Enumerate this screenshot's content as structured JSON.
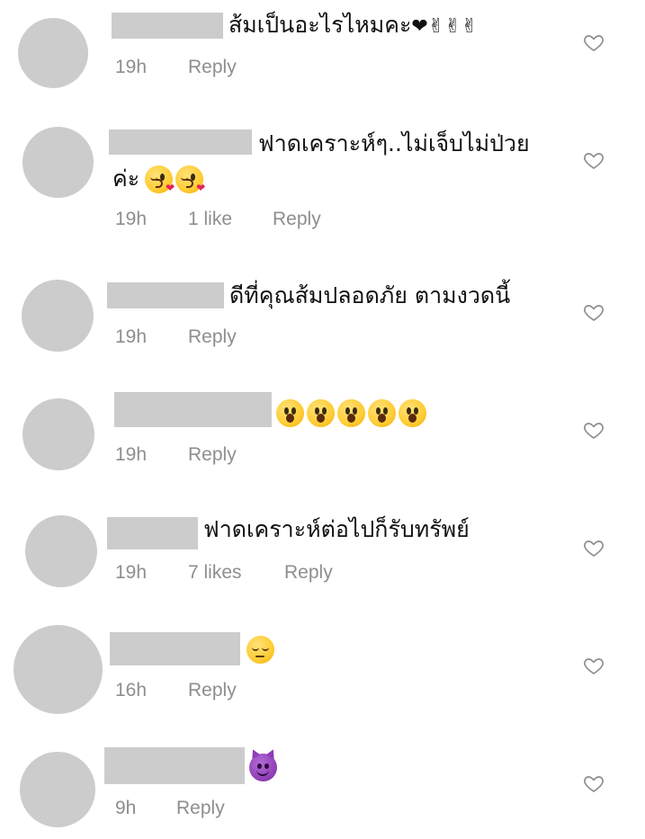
{
  "comments": [
    {
      "text": "ส้มเป็นอะไรไหมคะ",
      "text_suffix_symbols": "❤✌✌✌",
      "time": "19h",
      "likes": "",
      "reply": "Reply"
    },
    {
      "text_line1": "ฟาดเคราะห์ๆ..ไม่เจ็บไม่ป่วย",
      "text_line2": "ค่ะ",
      "emoji": [
        "face-blowing-kiss",
        "face-blowing-kiss"
      ],
      "time": "19h",
      "likes": "1 like",
      "reply": "Reply"
    },
    {
      "text": "ดีที่คุณส้มปลอดภัย  ตามงวดนี้",
      "time": "19h",
      "likes": "",
      "reply": "Reply"
    },
    {
      "text": "",
      "emoji": [
        "face-open-mouth",
        "face-open-mouth",
        "face-open-mouth",
        "face-open-mouth",
        "face-open-mouth"
      ],
      "time": "19h",
      "likes": "",
      "reply": "Reply"
    },
    {
      "text": "ฟาดเคราะห์ต่อไปก็รับทรัพย์",
      "time": "19h",
      "likes": "7 likes",
      "reply": "Reply"
    },
    {
      "text": "",
      "emoji": [
        "pensive-face"
      ],
      "time": "16h",
      "likes": "",
      "reply": "Reply"
    },
    {
      "text": "",
      "emoji": [
        "smiling-face-with-horns"
      ],
      "time": "9h",
      "likes": "",
      "reply": "Reply"
    }
  ],
  "icons": {
    "like": "heart-outline-icon",
    "avatar": "avatar-placeholder",
    "username": "username-redacted-block"
  },
  "colors": {
    "placeholder_gray": "#cccccc",
    "meta_gray": "#8e8e8e",
    "text": "#111111",
    "heart_outline": "#8e8e8e"
  }
}
